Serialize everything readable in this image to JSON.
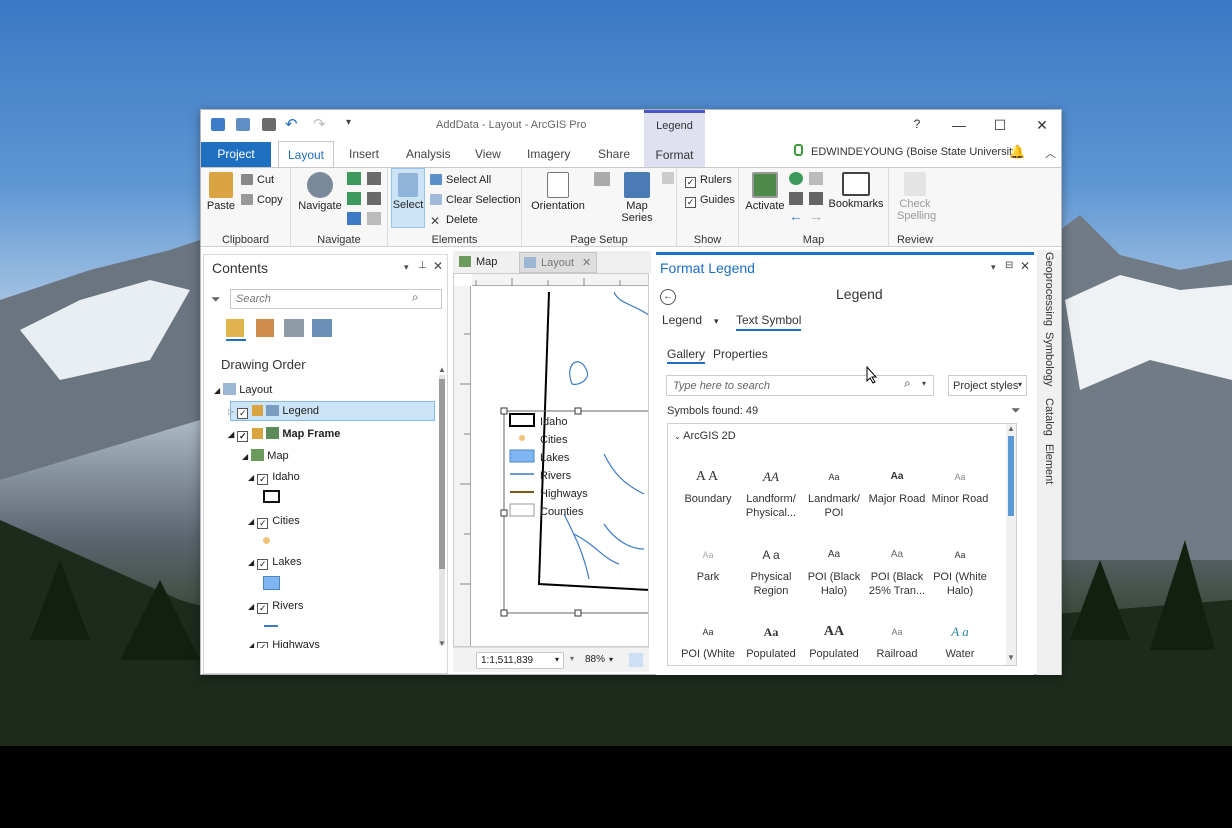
{
  "window": {
    "title": "AddData - Layout - ArcGIS Pro",
    "help": "?",
    "min": "—",
    "max": "☐",
    "close": "✕"
  },
  "contextual_tab": {
    "group": "Legend",
    "tab": "Format"
  },
  "tabs": [
    "Project",
    "Layout",
    "Insert",
    "Analysis",
    "View",
    "Imagery",
    "Share"
  ],
  "user": "EDWINDEYOUNG (Boise State University)",
  "ribbon": {
    "clipboard": {
      "label": "Clipboard",
      "paste": "Paste",
      "cut": "Cut",
      "copy": "Copy"
    },
    "navigate": {
      "label": "Navigate",
      "navigate": "Navigate"
    },
    "elements": {
      "label": "Elements",
      "select": "Select",
      "select_all": "Select All",
      "clear_selection": "Clear Selection",
      "delete": "Delete"
    },
    "page_setup": {
      "label": "Page Setup",
      "orientation": "Orientation",
      "map_series": "Map Series"
    },
    "show": {
      "label": "Show",
      "rulers": "Rulers",
      "guides": "Guides"
    },
    "map": {
      "label": "Map",
      "activate": "Activate",
      "bookmarks": "Bookmarks"
    },
    "review": {
      "label": "Review",
      "check_spelling": "Check Spelling"
    }
  },
  "contents": {
    "title": "Contents",
    "search_placeholder": "Search",
    "drawing_order": "Drawing Order",
    "items": {
      "layout": "Layout",
      "legend": "Legend",
      "map_frame": "Map Frame",
      "map": "Map",
      "idaho": "Idaho",
      "cities": "Cities",
      "lakes": "Lakes",
      "rivers": "Rivers",
      "highways": "Highways"
    }
  },
  "view_tabs": {
    "map": "Map",
    "layout": "Layout"
  },
  "status": {
    "scale": "1:1,511,839",
    "zoom": "88%"
  },
  "legend_items": [
    "Idaho",
    "Cities",
    "Lakes",
    "Rivers",
    "Highways",
    "Counties"
  ],
  "format_pane": {
    "title": "Format Legend",
    "header": "Legend",
    "dropdown": "Legend",
    "text_symbol": "Text Symbol",
    "gallery": "Gallery",
    "properties": "Properties",
    "search_placeholder": "Type here to search",
    "styles": "Project styles",
    "found": "Symbols found: 49",
    "category": "ArcGIS 2D",
    "symbols": [
      {
        "glyph": "AA",
        "label": "Boundary"
      },
      {
        "glyph": "AA",
        "label": "Landform/ Physical..."
      },
      {
        "glyph": "Aa",
        "label": "Landmark/ POI"
      },
      {
        "glyph": "Aa",
        "label": "Major Road"
      },
      {
        "glyph": "Aa",
        "label": "Minor Road"
      },
      {
        "glyph": "Aa",
        "label": "Park"
      },
      {
        "glyph": "A a",
        "label": "Physical Region"
      },
      {
        "glyph": "Aa",
        "label": "POI (Black Halo)"
      },
      {
        "glyph": "Aa",
        "label": "POI (Black 25% Tran..."
      },
      {
        "glyph": "Aa",
        "label": "POI (White Halo)"
      },
      {
        "glyph": "Aa",
        "label": "POI (White"
      },
      {
        "glyph": "Aa",
        "label": "Populated"
      },
      {
        "glyph": "AA",
        "label": "Populated"
      },
      {
        "glyph": "Aa",
        "label": "Railroad"
      },
      {
        "glyph": "A a",
        "label": "Water"
      }
    ]
  },
  "side_tabs": [
    "Geoprocessing",
    "Symbology",
    "Catalog",
    "Element"
  ],
  "colors": {
    "accent": "#1f6fc1",
    "contextual": "#dfe0f0",
    "selection": "#cce4f7"
  }
}
